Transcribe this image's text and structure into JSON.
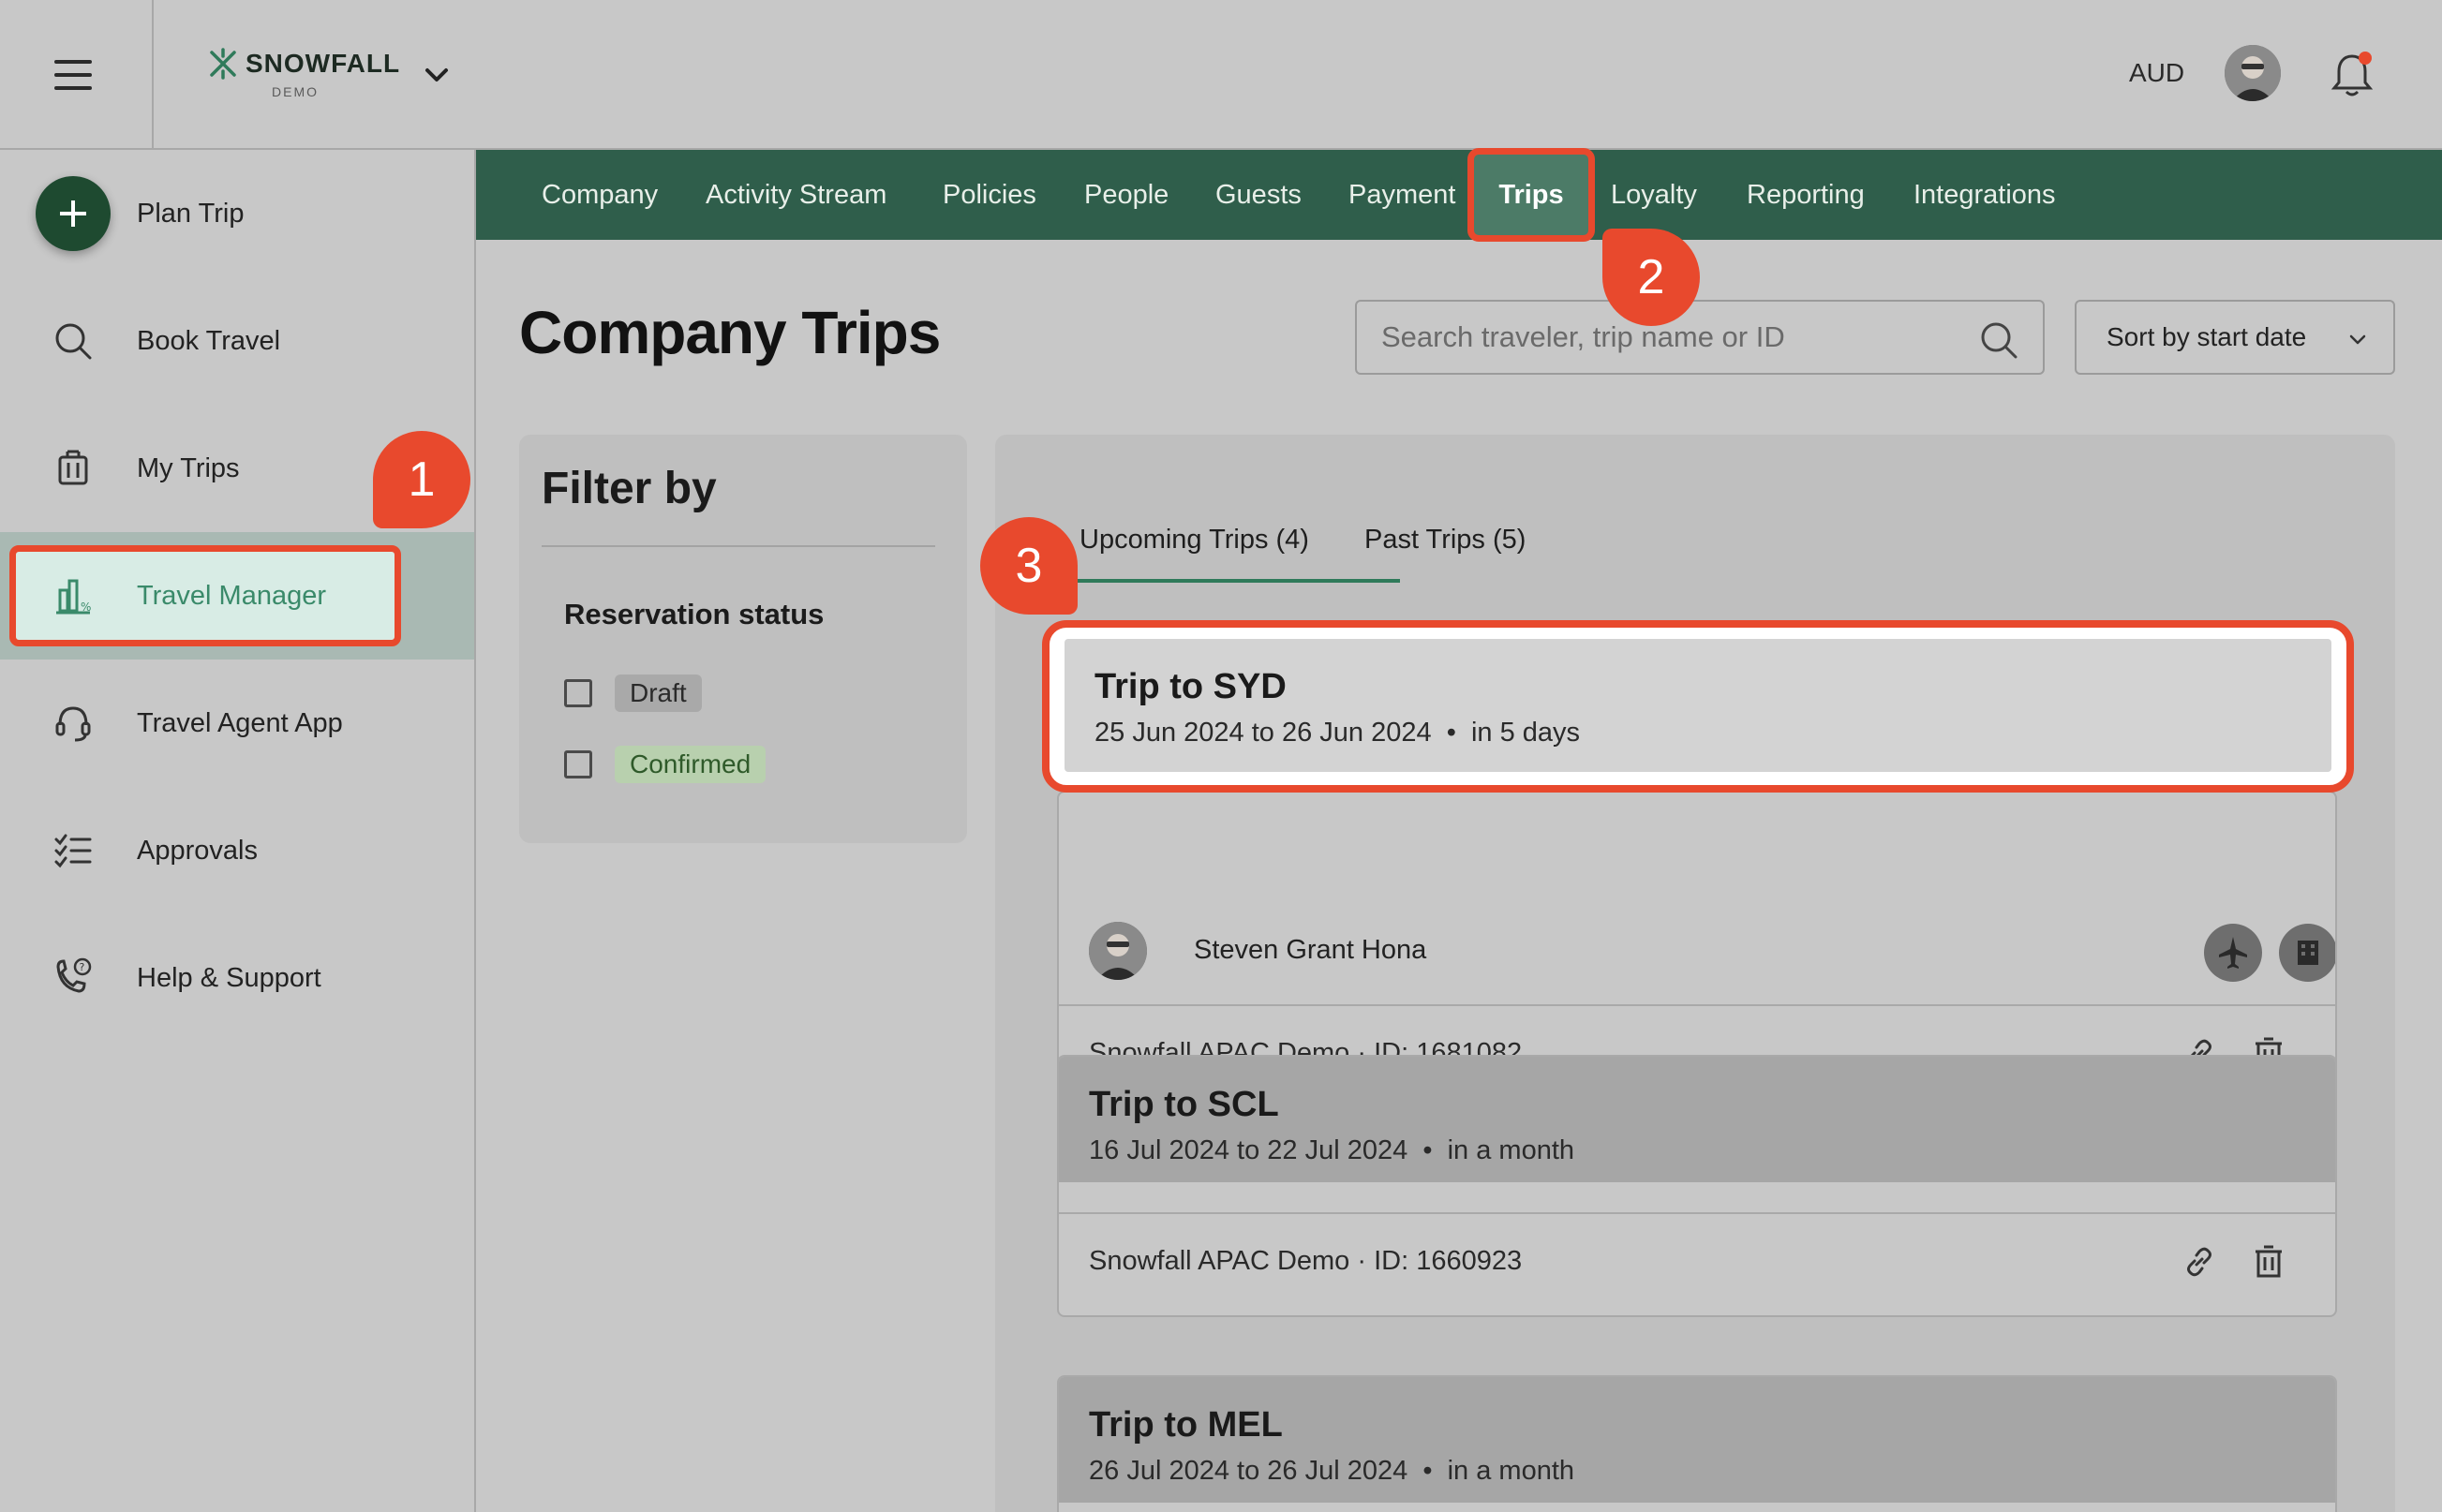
{
  "header": {
    "logo_text": "SNOWFALL",
    "logo_sub": "DEMO",
    "currency": "AUD"
  },
  "sidebar": {
    "items": [
      {
        "label": "Plan Trip",
        "icon": "plus-icon"
      },
      {
        "label": "Book Travel",
        "icon": "search-icon"
      },
      {
        "label": "My Trips",
        "icon": "luggage-icon"
      },
      {
        "label": "Travel Manager",
        "icon": "chart-icon"
      },
      {
        "label": "Travel Agent App",
        "icon": "headset-icon"
      },
      {
        "label": "Approvals",
        "icon": "checklist-icon"
      },
      {
        "label": "Help & Support",
        "icon": "phone-help-icon"
      }
    ]
  },
  "nav": {
    "items": [
      "Company",
      "Activity Stream",
      "Policies",
      "People",
      "Guests",
      "Payment",
      "Trips",
      "Loyalty",
      "Reporting",
      "Integrations"
    ],
    "active": "Trips"
  },
  "badges": [
    "1",
    "2",
    "3"
  ],
  "main": {
    "title": "Company Trips",
    "search_placeholder": "Search traveler, trip name or ID",
    "sort_label": "Sort by start date"
  },
  "filter": {
    "title": "Filter by",
    "section": "Reservation status",
    "options": [
      "Draft",
      "Confirmed"
    ]
  },
  "tabs": {
    "upcoming": "Upcoming Trips (4)",
    "past": "Past Trips (5)"
  },
  "trips": [
    {
      "name": "Trip to SYD",
      "dates": "25 Jun 2024 to 26 Jun 2024",
      "relative": "in 5 days",
      "traveler": "Steven Grant Hona",
      "meta": "Snowfall APAC Demo · ID: 1681082"
    },
    {
      "name": "Trip to SCL",
      "dates": "16 Jul 2024 to 22 Jul 2024",
      "relative": "in a month",
      "meta": "Snowfall APAC Demo · ID: 1660923"
    },
    {
      "name": "Trip to MEL",
      "dates": "26 Jul 2024 to 26 Jul 2024",
      "relative": "in a month"
    }
  ],
  "colors": {
    "accent_red": "#e8492d",
    "nav_green": "#2f5e4b",
    "active_green": "#3a8a6a"
  }
}
